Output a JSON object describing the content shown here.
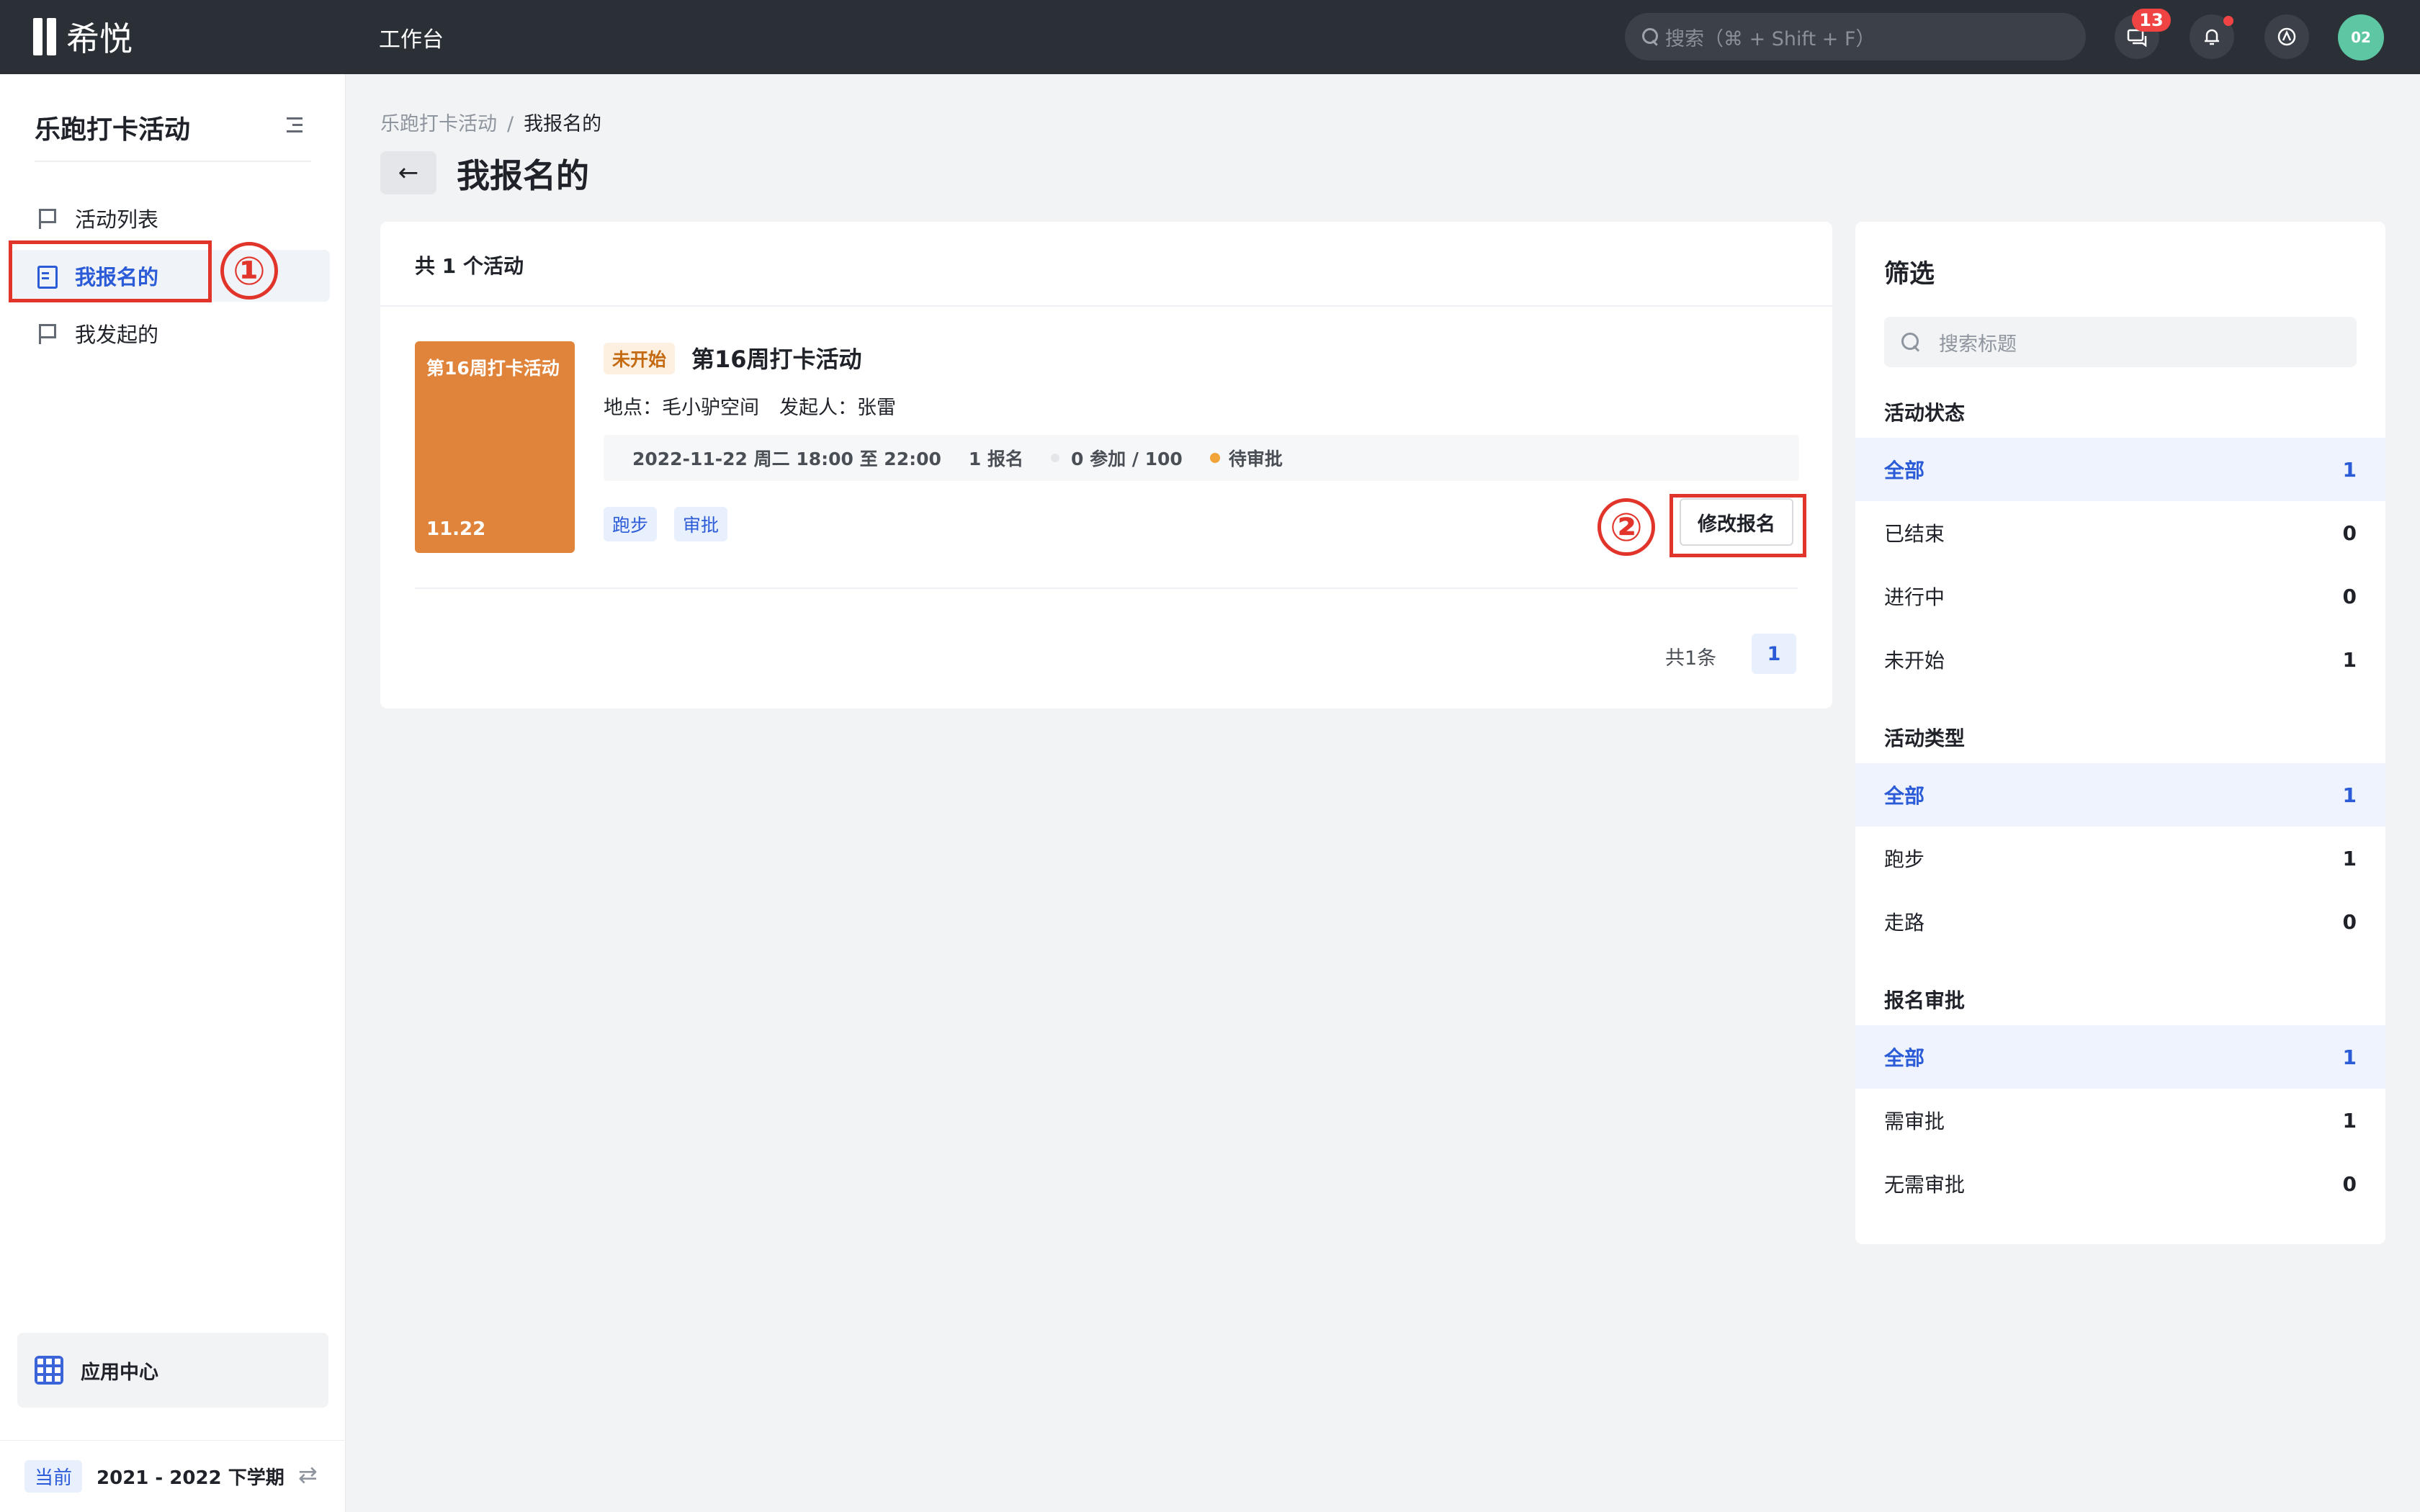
{
  "topbar": {
    "logo_text": "希悦",
    "workbench": "工作台",
    "search_placeholder": "搜索（⌘ + Shift + F）",
    "message_badge": "13",
    "avatar_text": "02"
  },
  "sidebar": {
    "title": "乐跑打卡活动",
    "items": [
      {
        "label": "活动列表"
      },
      {
        "label": "我报名的"
      },
      {
        "label": "我发起的"
      }
    ],
    "app_center": "应用中心",
    "term_tag": "当前",
    "term_text": "2021 - 2022 下学期"
  },
  "annotations": {
    "one": "①",
    "two": "②"
  },
  "breadcrumb": {
    "root": "乐跑打卡活动",
    "sep": "/",
    "current": "我报名的"
  },
  "page_title": "我报名的",
  "list": {
    "count_text": "共 1 个活动",
    "items": [
      {
        "cover_title": "第16周打卡活动",
        "cover_date": "11.22",
        "status": "未开始",
        "title": "第16周打卡活动",
        "location": "地点：毛小驴空间",
        "organizer": "发起人：张雷",
        "time": "2022-11-22 周二 18:00 至 22:00",
        "signups": "1 报名",
        "participants": "0 参加 / 100",
        "approval": "待审批",
        "tags": [
          "跑步",
          "审批"
        ],
        "action": "修改报名"
      }
    ],
    "total": "共1条",
    "page": "1"
  },
  "filter": {
    "title": "筛选",
    "search_placeholder": "搜索标题",
    "groups": [
      {
        "title": "活动状态",
        "options": [
          {
            "label": "全部",
            "count": "1"
          },
          {
            "label": "已结束",
            "count": "0"
          },
          {
            "label": "进行中",
            "count": "0"
          },
          {
            "label": "未开始",
            "count": "1"
          }
        ]
      },
      {
        "title": "活动类型",
        "options": [
          {
            "label": "全部",
            "count": "1"
          },
          {
            "label": "跑步",
            "count": "1"
          },
          {
            "label": "走路",
            "count": "0"
          }
        ]
      },
      {
        "title": "报名审批",
        "options": [
          {
            "label": "全部",
            "count": "1"
          },
          {
            "label": "需审批",
            "count": "1"
          },
          {
            "label": "无需审批",
            "count": "0"
          }
        ]
      }
    ]
  },
  "colors": {
    "accent": "#2b5bd7",
    "cover": "#e0843b",
    "annotation": "#e1352b",
    "topbar": "#2b2f36"
  }
}
